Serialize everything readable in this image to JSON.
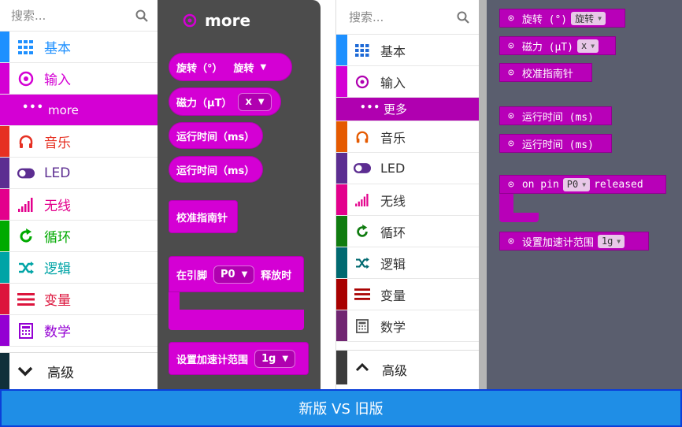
{
  "new_version": {
    "search_placeholder": "搜索...",
    "categories": [
      {
        "label": "基本",
        "color": "#1e90ff"
      },
      {
        "label": "输入",
        "color": "#d400d4"
      },
      {
        "label": "more",
        "color": "#d400d4"
      },
      {
        "label": "音乐",
        "color": "#e63022"
      },
      {
        "label": "LED",
        "color": "#5c2d91"
      },
      {
        "label": "无线",
        "color": "#e3008c"
      },
      {
        "label": "循环",
        "color": "#00aa00"
      },
      {
        "label": "逻辑",
        "color": "#00a4a6"
      },
      {
        "label": "变量",
        "color": "#dc143c"
      },
      {
        "label": "数学",
        "color": "#9400d3"
      }
    ],
    "advanced_label": "高级",
    "flyout": {
      "title": "more",
      "blocks": {
        "rotation_label": "旋转（°）",
        "rotation_value": "旋转",
        "magnetic_label": "磁力（µT）",
        "magnetic_value": "x",
        "runtime1": "运行时间（ms）",
        "runtime2": "运行时间（ms）",
        "calibrate": "校准指南针",
        "pin_prefix": "在引脚",
        "pin_value": "P0",
        "pin_suffix": "释放时",
        "accel_label": "设置加速计范围",
        "accel_value": "1g"
      }
    }
  },
  "old_version": {
    "search_placeholder": "搜索...",
    "categories": [
      {
        "label": "基本",
        "color": "#1e90ff"
      },
      {
        "label": "输入",
        "color": "#d400d4"
      },
      {
        "label": "更多",
        "color": "#d400d4"
      },
      {
        "label": "音乐",
        "color": "#e55a00"
      },
      {
        "label": "LED",
        "color": "#5c2d91"
      },
      {
        "label": "无线",
        "color": "#e3008c"
      },
      {
        "label": "循环",
        "color": "#107c10"
      },
      {
        "label": "逻辑",
        "color": "#006970"
      },
      {
        "label": "变量",
        "color": "#a80000"
      },
      {
        "label": "数学",
        "color": "#712672"
      }
    ],
    "advanced_label": "高级",
    "flyout": {
      "rotation_label": "旋转 (°)",
      "rotation_value": "旋转",
      "magnetic_label": "磁力 (µT)",
      "magnetic_value": "x",
      "calibrate": "校准指南针",
      "runtime1": "运行时间 (ms)",
      "runtime2": "运行时间 (ms)",
      "pin_prefix": "on pin",
      "pin_value": "P0",
      "pin_suffix": "released",
      "accel_label": "设置加速计范围",
      "accel_value": "1g"
    }
  },
  "banner": {
    "text": "新版 VS 旧版"
  }
}
